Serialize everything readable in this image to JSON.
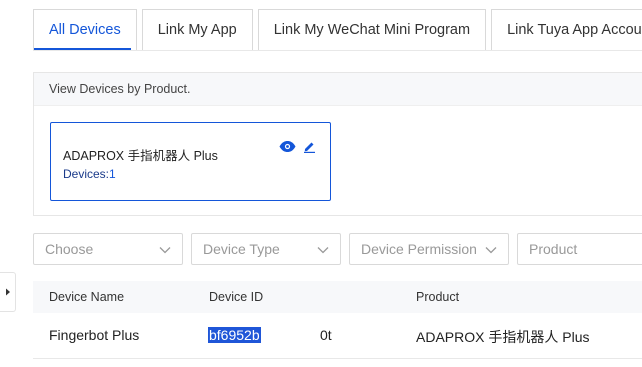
{
  "tabs": [
    {
      "label": "All Devices",
      "active": true
    },
    {
      "label": "Link My App",
      "active": false
    },
    {
      "label": "Link My WeChat Mini Program",
      "active": false
    },
    {
      "label": "Link Tuya App Account",
      "active": false
    }
  ],
  "panel": {
    "header": "View Devices by Product.",
    "card": {
      "name": "ADAPROX 手指机器人 Plus",
      "devices_label": "Devices:",
      "devices_count": "1",
      "view_icon": "eye-icon",
      "edit_icon": "pencil-icon"
    }
  },
  "filters": {
    "choose": "Choose",
    "device_type": "Device Type",
    "device_permission": "Device Permission",
    "product": "Product"
  },
  "table": {
    "headers": [
      "Device Name",
      "Device ID",
      "Product"
    ],
    "rows": [
      {
        "name": "Fingerbot Plus",
        "id_selected": "bf6952b",
        "id_rest": "0t",
        "product": "ADAPROX 手指机器人 Plus"
      }
    ]
  },
  "colors": {
    "accent": "#1456d9",
    "selection": "#1f56d8",
    "header_bg": "#f7f8fa",
    "border": "#d9d9d9"
  }
}
